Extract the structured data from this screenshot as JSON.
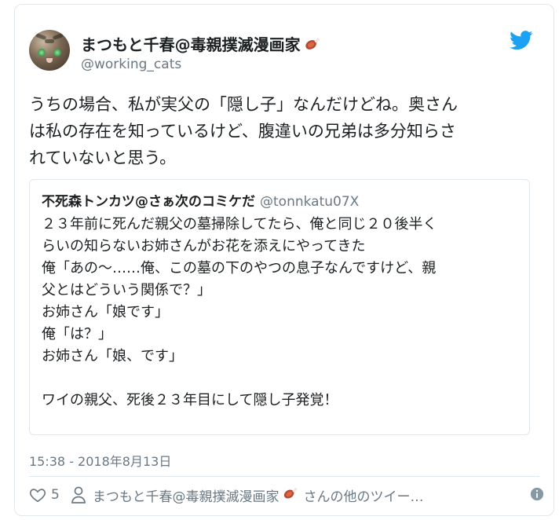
{
  "author": {
    "name": "まつもと千春@毒親撲滅漫画家",
    "handle": "@working_cats",
    "name_emoji": "meat-on-bone-icon"
  },
  "brand": {
    "icon": "twitter-bird-icon",
    "color": "#1da1f2"
  },
  "tweet": {
    "text": "うちの場合、私が実父の「隠し子」なんだけどね。奥さん\nは私の存在を知っているけど、腹違いの兄弟は多分知らさ\nれていないと思う。"
  },
  "quoted": {
    "name": "不死森トンカツ@さぁ次のコミケだ",
    "handle": "@tonnkatu07X",
    "text": "２３年前に死んだ親父の墓掃除してたら、俺と同じ２０後半く\nらいの知らないお姉さんがお花を添えにやってきた\n俺「あの～……俺、この墓の下のやつの息子なんですけど、親\n父とはどういう関係で？」\nお姉さん「娘です」\n俺「は？」\nお姉さん「娘、です」\n\nワイの親父、死後２３年目にして隠し子発覚！"
  },
  "timestamp": "15:38 - 2018年8月13日",
  "footer": {
    "like_count": "5",
    "more_tweets_name": "まつもと千春@毒親撲滅漫画家",
    "more_tweets_suffix": "さんの他のツイー…",
    "info_icon": "info-icon"
  },
  "colors": {
    "muted": "#697882",
    "border": "#e1e8ed",
    "text": "#1c2022"
  }
}
